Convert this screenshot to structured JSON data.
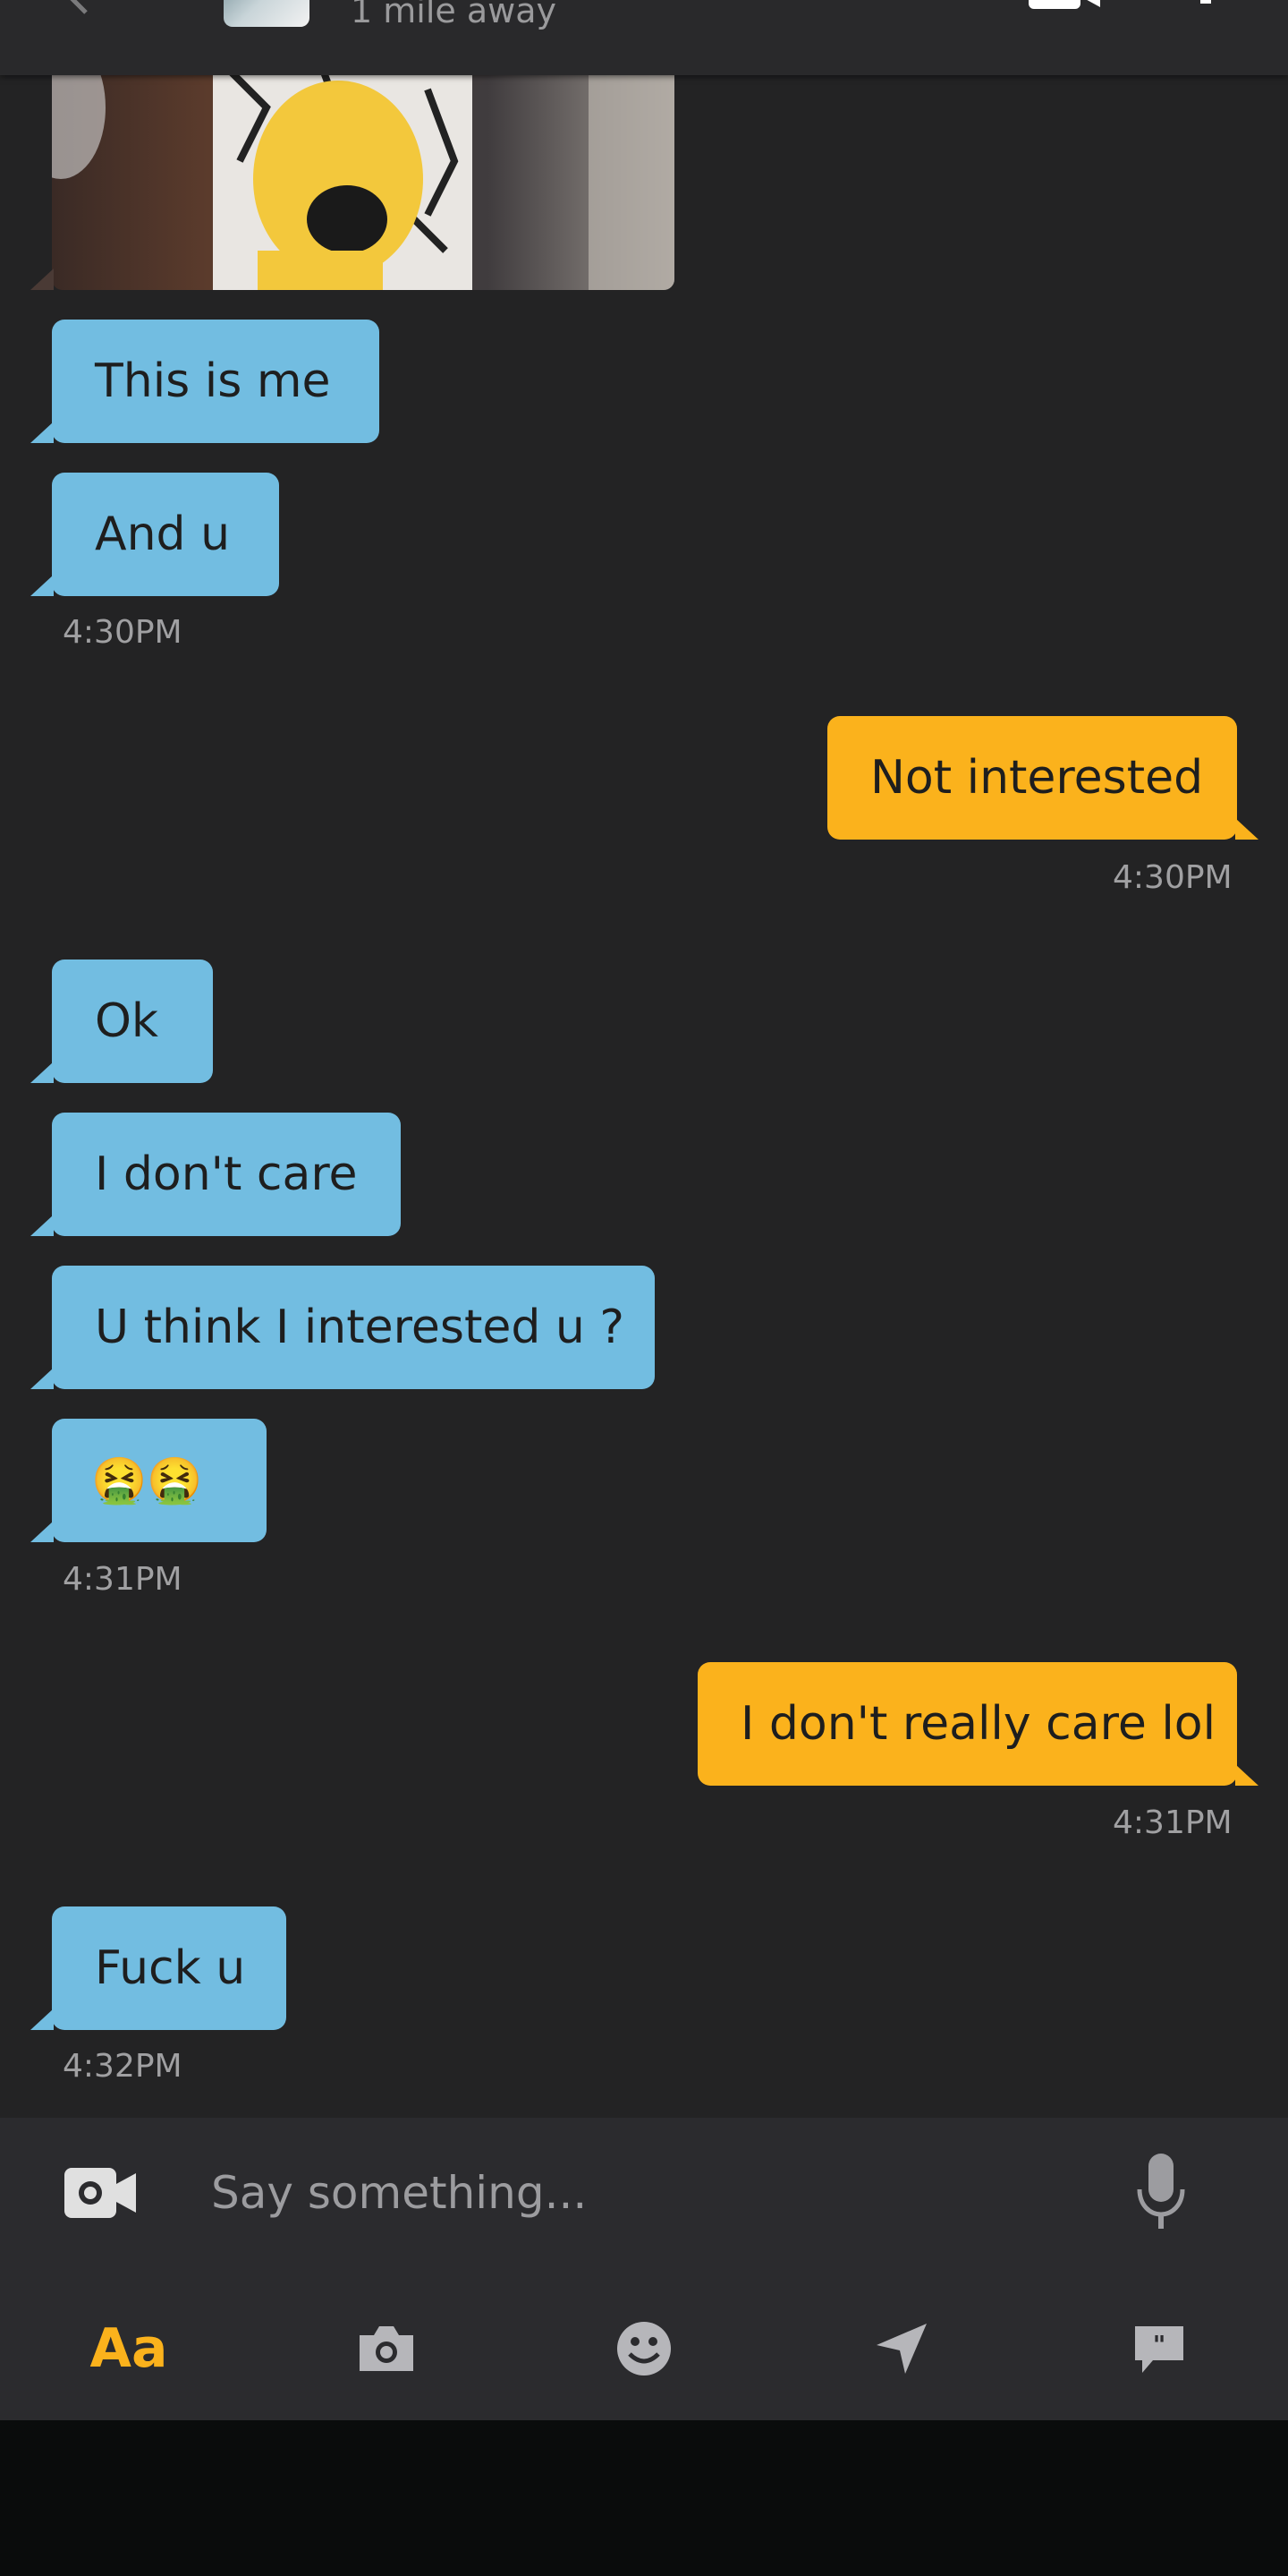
{
  "header": {
    "distance": "1 mile away"
  },
  "messages": [
    {
      "side": "in",
      "text": "This is me"
    },
    {
      "side": "in",
      "text": "And u"
    },
    {
      "side": "out",
      "text": "Not interested"
    },
    {
      "side": "in",
      "text": "Ok"
    },
    {
      "side": "in",
      "text": "I don't care"
    },
    {
      "side": "in",
      "text": "U think I interested u ?"
    },
    {
      "side": "in",
      "text": "🤮🤮"
    },
    {
      "side": "out",
      "text": "I don't really care lol"
    },
    {
      "side": "in",
      "text": "Fuck u"
    }
  ],
  "timestamps": {
    "t1": "4:30PM",
    "t2": "4:30PM",
    "t3": "4:31PM",
    "t4": "4:31PM",
    "t5": "4:32PM"
  },
  "composer": {
    "placeholder": "Say something...",
    "value": ""
  },
  "toolbar": {
    "text_tool_label": "Aa",
    "icons": [
      "camera-icon",
      "emoji-icon",
      "location-icon",
      "saved-phrases-icon"
    ]
  },
  "colors": {
    "incoming_bubble": "#72bde1",
    "outgoing_bubble": "#fbb21c",
    "background": "#232324",
    "accent": "#fbb21c"
  }
}
